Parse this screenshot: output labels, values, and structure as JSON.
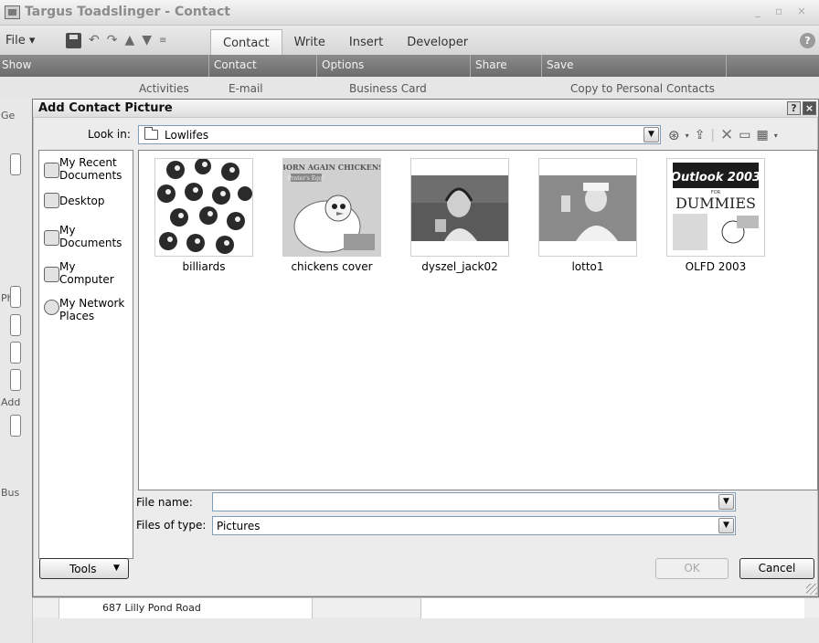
{
  "window": {
    "title": "Targus Toadslinger - Contact",
    "file_tab": "File",
    "tabs": [
      "Contact",
      "Write",
      "Insert",
      "Developer"
    ],
    "groups": [
      "Show",
      "Contact",
      "Options",
      "Share",
      "Save"
    ],
    "ribbon_peek": [
      "Activities",
      "E-mail",
      "Business Card",
      "Copy to Personal Contacts"
    ],
    "left_labels": [
      "Ge",
      "Phc",
      "Add",
      "Bus"
    ],
    "address_line": "687 Lilly Pond Road"
  },
  "dialog": {
    "title": "Add Contact Picture",
    "look_in_label": "Look in:",
    "look_in_value": "Lowlifes",
    "places": [
      "My Recent Documents",
      "Desktop",
      "My Documents",
      "My Computer",
      "My Network Places"
    ],
    "files": [
      {
        "name": "billiards"
      },
      {
        "name": "chickens cover",
        "thumb_text": [
          "BORN AGAIN CHICKENS",
          "Prater's Egg!"
        ]
      },
      {
        "name": "dyszel_jack02"
      },
      {
        "name": "lotto1"
      },
      {
        "name": "OLFD 2003",
        "thumb_text": [
          "Outlook 2003",
          "FOR",
          "DUMMIES"
        ]
      }
    ],
    "file_name_label": "File name:",
    "file_name_value": "",
    "files_of_type_label": "Files of type:",
    "files_of_type_value": "Pictures",
    "tools_label": "Tools",
    "ok_label": "OK",
    "cancel_label": "Cancel"
  }
}
